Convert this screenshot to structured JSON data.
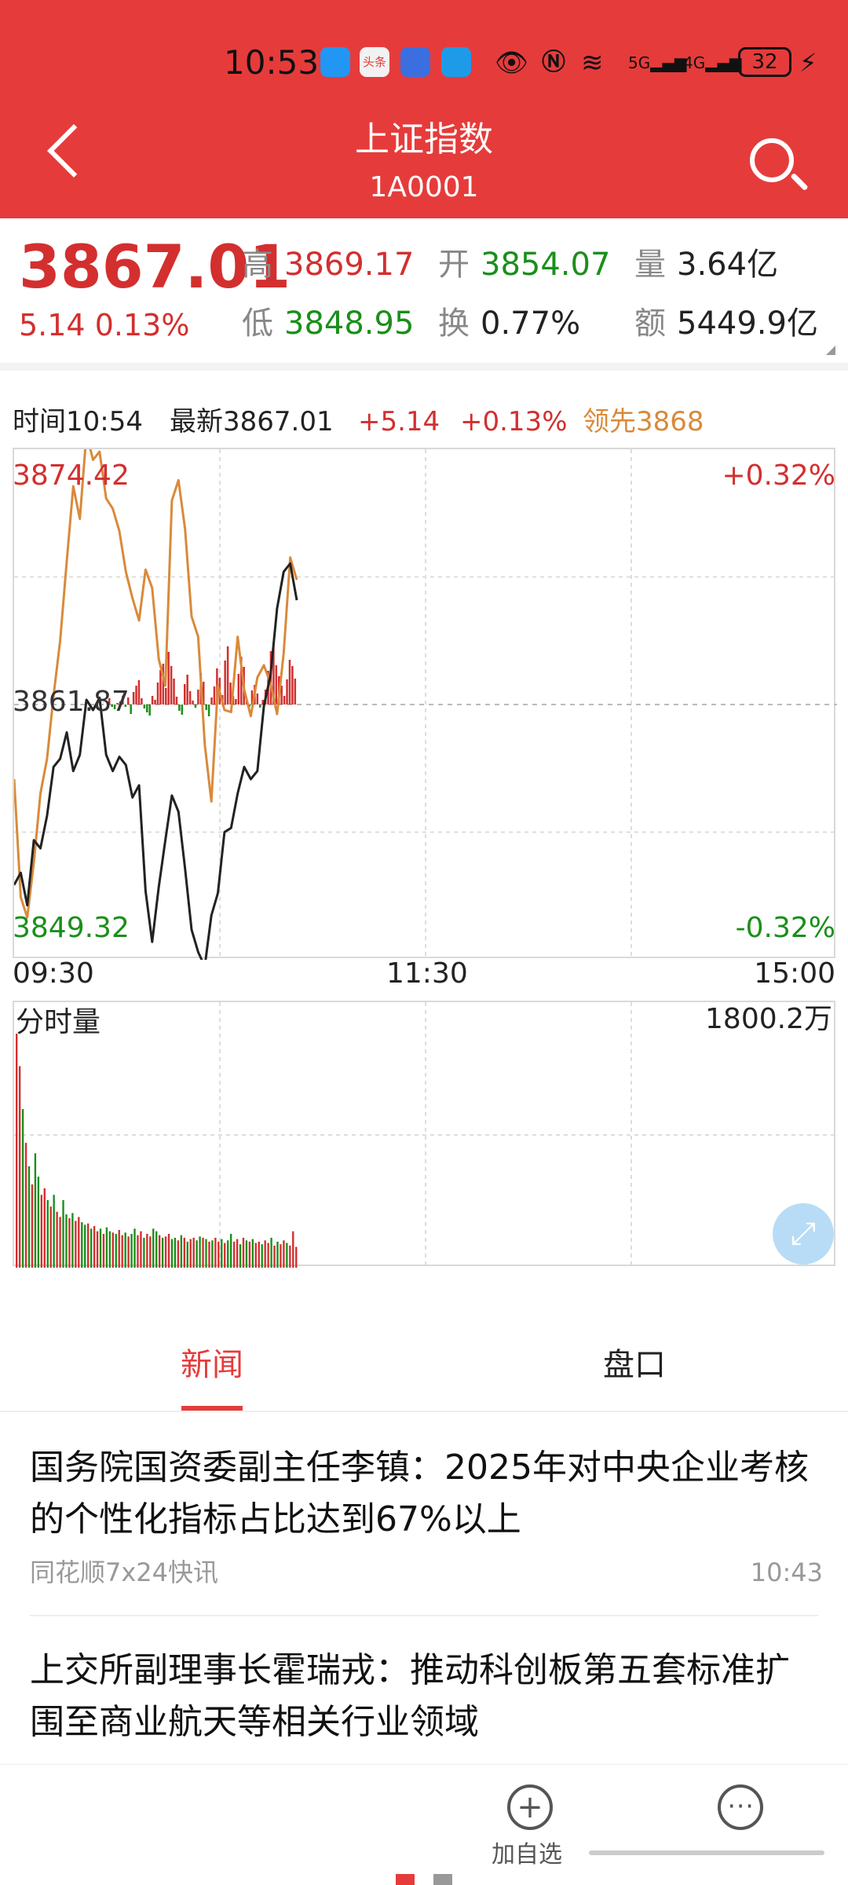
{
  "status_bar": {
    "time": "10:53",
    "battery": "32",
    "icons": [
      "chat-app-icon",
      "toutiao-app-icon",
      "shield-app-icon",
      "search-app-icon",
      "eye-icon",
      "nfc-icon",
      "wifi-icon",
      "signal-5g-icon",
      "signal-4g-icon",
      "charging-icon"
    ],
    "app_badge_toutiao": "头条",
    "net_5g": "5G",
    "net_4g": "4G"
  },
  "header": {
    "title": "上证指数",
    "code": "1A0001"
  },
  "quote": {
    "price": "3867.01",
    "change": "5.14",
    "change_pct": "0.13%",
    "high_label": "高",
    "high": "3869.17",
    "open_label": "开",
    "open": "3854.07",
    "volume_label": "量",
    "volume": "3.64亿",
    "low_label": "低",
    "low": "3848.95",
    "turnover_label": "换",
    "turnover": "0.77%",
    "amount_label": "额",
    "amount": "5449.9亿"
  },
  "chart_info": {
    "time": "时间10:54",
    "latest": "最新3867.01",
    "change": "+5.14",
    "change_pct": "+0.13%",
    "leading": "领先3868"
  },
  "price_chart_labels": {
    "y_top": "3874.42",
    "y_mid": "3861.87",
    "y_bottom": "3849.32",
    "pct_top": "+0.32%",
    "pct_bottom": "-0.32%",
    "x_start": "09:30",
    "x_mid": "11:30",
    "x_end": "15:00"
  },
  "volume_chart_labels": {
    "title": "分时量",
    "max": "1800.2万"
  },
  "colors": {
    "brand_red": "#e63b3b",
    "up_red": "#d32f2f",
    "down_green": "#1a8f1a",
    "leading_line": "#d98a3a",
    "price_line": "#222222"
  },
  "chart_data": [
    {
      "type": "line",
      "x_range": [
        "09:30",
        "15:00"
      ],
      "ylim": [
        3849.32,
        3874.42
      ],
      "prev_close": 3861.87,
      "series": [
        {
          "name": "最新",
          "values": [
            3853.0,
            3853.6,
            3852.0,
            3855.2,
            3854.8,
            3856.4,
            3858.8,
            3859.2,
            3860.5,
            3858.6,
            3859.4,
            3862.1,
            3861.6,
            3862.2,
            3859.4,
            3858.6,
            3859.3,
            3858.9,
            3857.3,
            3857.9,
            3852.7,
            3850.2,
            3852.9,
            3855.2,
            3857.4,
            3856.6,
            3853.8,
            3850.8,
            3849.7,
            3849.0,
            3851.5,
            3852.6,
            3855.6,
            3855.8,
            3857.5,
            3858.8,
            3858.2,
            3858.6,
            3861.8,
            3863.3,
            3866.6,
            3868.4,
            3868.8,
            3867.0
          ]
        },
        {
          "name": "领先",
          "values": [
            3858.2,
            3852.4,
            3851.4,
            3854.1,
            3857.5,
            3859.2,
            3862.3,
            3865.0,
            3868.9,
            3872.6,
            3871.0,
            3875.2,
            3873.9,
            3874.3,
            3872.0,
            3871.5,
            3870.4,
            3868.4,
            3867.1,
            3866.0,
            3868.5,
            3867.6,
            3864.1,
            3862.8,
            3871.9,
            3872.9,
            3870.5,
            3866.2,
            3865.2,
            3859.9,
            3857.1,
            3862.8,
            3861.6,
            3861.5,
            3865.2,
            3862.6,
            3861.3,
            3863.2,
            3863.8,
            3862.9,
            3861.4,
            3864.4,
            3869.1,
            3868.0
          ]
        },
        {
          "name": "涨跌柱",
          "values": [
            0.8,
            -0.3,
            -0.6,
            0.2,
            0.4,
            1.1,
            -0.3,
            0.9,
            -1.2,
            1.6,
            2.4,
            3.1,
            0.8,
            -0.5,
            -1.0,
            -1.4,
            1.1,
            0.6,
            2.8,
            4.4,
            5.2,
            2.1,
            6.7,
            4.9,
            3.3,
            1.0,
            -0.8,
            -1.3,
            2.6,
            3.8,
            1.7,
            0.5,
            -0.4,
            1.9,
            4.0,
            2.9,
            -0.7,
            -1.5,
            0.9,
            2.3,
            4.6,
            3.4,
            1.2,
            5.6,
            7.4,
            2.8,
            1.1,
            0.7,
            3.9,
            6.1,
            4.8,
            0.5,
            -0.3,
            1.8,
            2.5,
            1.4,
            -0.4,
            0.6,
            1.9,
            4.3,
            6.8,
            7.9,
            5.0,
            3.6,
            2.4,
            1.1,
            3.2,
            5.7,
            4.9,
            3.3
          ]
        }
      ]
    },
    {
      "type": "bar",
      "title": "分时量",
      "ymax": 1800.2,
      "unit": "万",
      "series": [
        {
          "name": "分时量",
          "values": [
            1800,
            1550,
            1220,
            960,
            780,
            640,
            880,
            700,
            560,
            610,
            520,
            470,
            560,
            430,
            390,
            520,
            410,
            380,
            420,
            360,
            390,
            350,
            330,
            340,
            300,
            320,
            280,
            300,
            260,
            310,
            280,
            270,
            260,
            290,
            250,
            270,
            240,
            260,
            300,
            250,
            280,
            230,
            260,
            240,
            300,
            280,
            250,
            230,
            240,
            260,
            220,
            230,
            210,
            250,
            230,
            200,
            220,
            230,
            210,
            240,
            230,
            220,
            200,
            210,
            230,
            200,
            220,
            190,
            210,
            260,
            200,
            220,
            180,
            230,
            210,
            200,
            220,
            190,
            200,
            180,
            210,
            190,
            230,
            170,
            200,
            180,
            210,
            190,
            170,
            280,
            160
          ]
        },
        {
          "name": "colors",
          "values": [
            1,
            1,
            0,
            1,
            0,
            1,
            0,
            0,
            1,
            1,
            0,
            1,
            0,
            1,
            1,
            0,
            0,
            1,
            0,
            1,
            1,
            0,
            0,
            1,
            0,
            1,
            1,
            0,
            1,
            0,
            0,
            1,
            0,
            1,
            1,
            0,
            1,
            0,
            0,
            1,
            1,
            0,
            1,
            1,
            0,
            0,
            1,
            0,
            1,
            1,
            0,
            0,
            1,
            0,
            1,
            0,
            1,
            1,
            0,
            0,
            1,
            0,
            1,
            0,
            1,
            1,
            0,
            1,
            0,
            0,
            1,
            1,
            0,
            1,
            0,
            1,
            0,
            1,
            1,
            0,
            1,
            1,
            0,
            1,
            0,
            1,
            1,
            0,
            1,
            1,
            1
          ]
        }
      ]
    }
  ],
  "tabs": [
    "新闻",
    "盘口"
  ],
  "news": [
    {
      "title": "国务院国资委副主任李镇：2025年对中央企业考核的个性化指标占比达到67%以上",
      "source": "同花顺7x24快讯",
      "time": "10:43"
    },
    {
      "title": "上交所副理事长霍瑞戎：推动科创板第五套标准扩围至商业航天等相关行业领域",
      "source": "",
      "time": ""
    }
  ],
  "bottom_bar": {
    "add_watch_label": "加自选"
  }
}
